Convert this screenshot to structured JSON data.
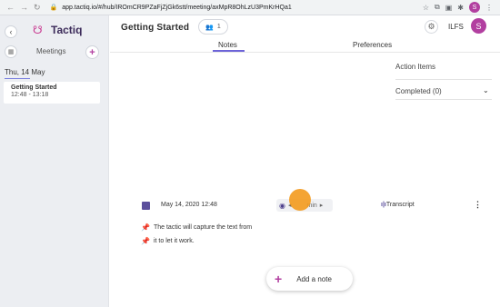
{
  "browser": {
    "url": "app.tactiq.io/#/hub/IROmCR9PZaFjZjGk6stt/meeting/axMpR8OhLzU3PmKrHQa1"
  },
  "sidebar": {
    "app_name": "Tactiq",
    "section_title": "Meetings",
    "date_label": "Thu, 14 May",
    "meetings": [
      {
        "title": "Getting Started",
        "time": "12:48 - 13:18"
      }
    ]
  },
  "header": {
    "title": "Getting Started",
    "participants_count": "1",
    "language": "ILFS",
    "avatar_letter": "S"
  },
  "tabs": [
    {
      "label": "Notes",
      "active": true
    },
    {
      "label": "Preferences",
      "active": false
    }
  ],
  "action_items": {
    "title": "Action Items",
    "completed_label": "Completed (0)"
  },
  "note": {
    "timestamp": "May 14, 2020 12:48",
    "player_label": "min",
    "transcript_label": "Transcript",
    "lines": [
      "The tactic will capture the text from",
      "it to let it work."
    ]
  },
  "add_note": {
    "label": "Add a note"
  },
  "colors": {
    "accent": "#b23fa0",
    "tab_indicator": "#6d64d8",
    "cursor_highlight": "#f39a1d"
  }
}
